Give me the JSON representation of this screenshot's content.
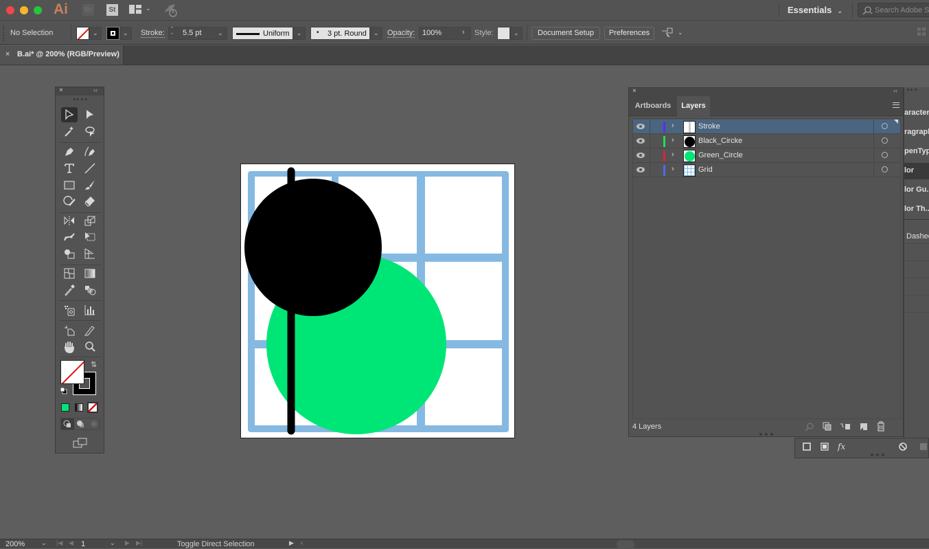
{
  "app": {
    "logo": "Ai",
    "bridge_label": "Br",
    "stock_label": "St",
    "workspace": "Essentials",
    "search_placeholder": "Search Adobe Stock"
  },
  "control_bar": {
    "selection_status": "No Selection",
    "stroke_label": "Stroke:",
    "stroke_weight": "5.5 pt",
    "profile": "Uniform",
    "brush": "3 pt. Round",
    "opacity_label": "Opacity:",
    "opacity_value": "100%",
    "style_label": "Style:",
    "document_setup": "Document Setup",
    "preferences": "Preferences"
  },
  "document_tab": {
    "close": "×",
    "title": "B.ai* @ 200% (RGB/Preview)"
  },
  "colors": {
    "fill": "none",
    "stroke": "#000000",
    "green": "#00e676",
    "grid_blue": "#85b9e2",
    "selection_blue": "#4b6580"
  },
  "artwork": {
    "objects": [
      "Grid",
      "Green_Circle",
      "Black_Circke",
      "Stroke"
    ]
  },
  "layers_panel": {
    "tabs": [
      {
        "label": "Artboards",
        "active": false
      },
      {
        "label": "Layers",
        "active": true
      }
    ],
    "layers": [
      {
        "name": "Stroke",
        "color": "#5a2cff",
        "selected": true,
        "visible": true,
        "thumb": "stroke"
      },
      {
        "name": "Black_Circke",
        "color": "#1ee04a",
        "selected": false,
        "visible": true,
        "thumb": "black-circle"
      },
      {
        "name": "Green_Circle",
        "color": "#e0203a",
        "selected": false,
        "visible": true,
        "thumb": "green-circle"
      },
      {
        "name": "Grid",
        "color": "#4a6cf0",
        "selected": false,
        "visible": true,
        "thumb": "grid"
      }
    ],
    "count_label": "4 Layers"
  },
  "side_panels": {
    "items": [
      "Character",
      "Paragraph",
      "OpenType",
      "Color",
      "Color Guide",
      "Color Themes",
      "Dashed"
    ],
    "visible_text": [
      "aracter",
      "ragraph",
      "penType",
      "lor",
      "lor Gu...",
      "lor Th...",
      "Dashed"
    ]
  },
  "status_bar": {
    "zoom": "200%",
    "artboard_number": "1",
    "tool_hint": "Toggle Direct Selection"
  }
}
